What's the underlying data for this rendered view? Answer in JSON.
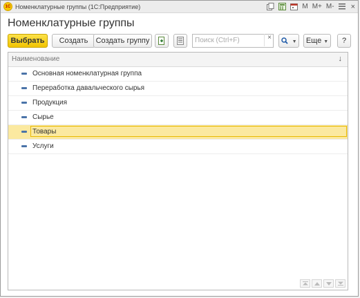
{
  "window": {
    "title": "Номенклатурные группы  (1С:Предприятие)",
    "logo_text": "1С",
    "tools": {
      "m": "M",
      "mplus": "M+",
      "mminus": "M-",
      "close": "×"
    }
  },
  "page_title": "Номенклатурные группы",
  "toolbar": {
    "select_label": "Выбрать",
    "create_label": "Создать",
    "create_group_label": "Создать группу",
    "search_placeholder": "Поиск (Ctrl+F)",
    "search_clear": "×",
    "more_label": "Еще",
    "help_label": "?"
  },
  "table": {
    "column_header": "Наименование",
    "sort_indicator": "↓",
    "rows": [
      {
        "label": "Основная номенклатурная группа"
      },
      {
        "label": "Переработка давальческого сырья"
      },
      {
        "label": "Продукция"
      },
      {
        "label": "Сырье"
      },
      {
        "label": "Товары",
        "selected": true
      },
      {
        "label": "Услуги"
      }
    ]
  },
  "colors": {
    "primary_button": "#f2c400",
    "selection": "#fbe9a0",
    "row_icon": "#4a73a8"
  }
}
